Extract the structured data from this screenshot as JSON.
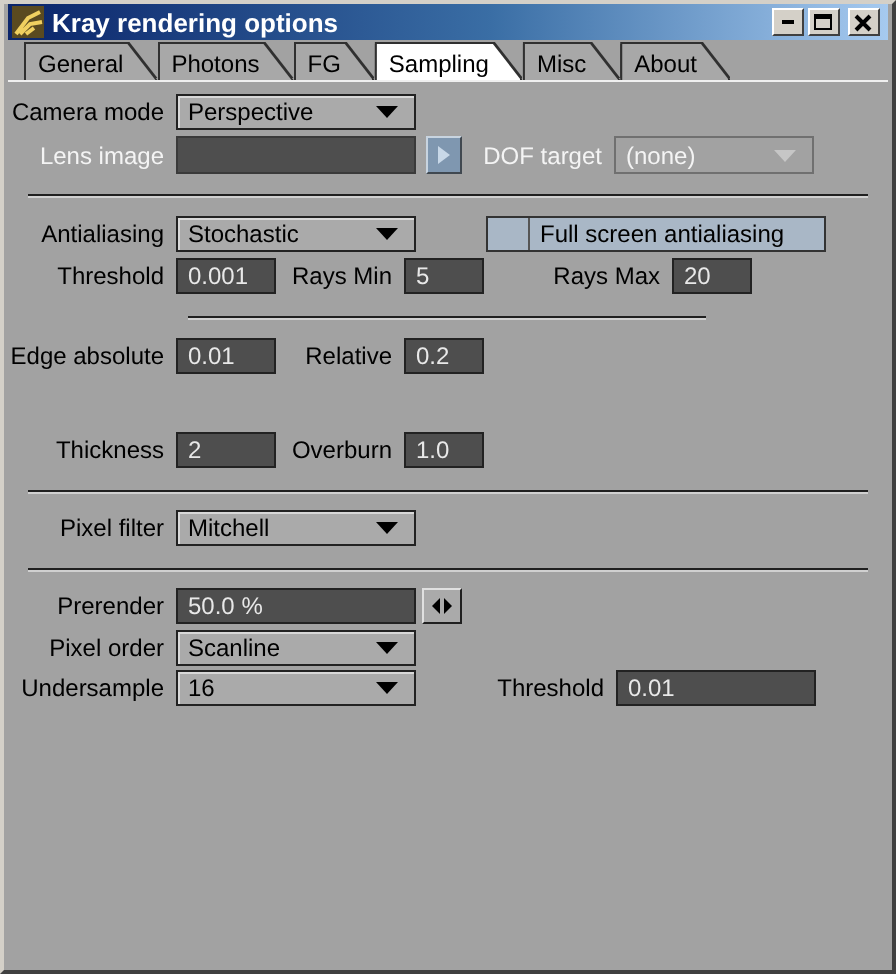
{
  "window": {
    "title": "Kray rendering options"
  },
  "tabs": [
    {
      "label": "General",
      "selected": false
    },
    {
      "label": "Photons",
      "selected": false
    },
    {
      "label": "FG",
      "selected": false
    },
    {
      "label": "Sampling",
      "selected": true
    },
    {
      "label": "Misc",
      "selected": false
    },
    {
      "label": "About",
      "selected": false
    }
  ],
  "rows": [
    {
      "kind": "controls",
      "items": [
        {
          "kind": "dropdown",
          "label": "Camera mode",
          "value": "Perspective",
          "disabled": false
        }
      ]
    },
    {
      "kind": "controls",
      "items": [
        {
          "kind": "field",
          "label": "Lens image",
          "disabled": true
        },
        {
          "kind": "arrow-button",
          "disabled": false
        },
        {
          "kind": "dropdown",
          "label": "DOF target",
          "value": "(none)",
          "disabled": true
        }
      ]
    },
    {
      "kind": "separator"
    },
    {
      "kind": "controls",
      "items": [
        {
          "kind": "dropdown",
          "label": "Antialiasing",
          "value": "Stochastic",
          "disabled": false
        },
        {
          "kind": "toggle",
          "label": "Full screen antialiasing",
          "checked": false
        }
      ]
    },
    {
      "kind": "controls",
      "items": [
        {
          "kind": "field",
          "label": "Threshold",
          "value": "0.001",
          "disabled": false
        },
        {
          "kind": "field",
          "label": "Rays Min",
          "value": "5",
          "disabled": false
        },
        {
          "kind": "field",
          "label": "Rays Max",
          "value": "20",
          "disabled": false
        }
      ]
    },
    {
      "kind": "short-separator"
    },
    {
      "kind": "controls",
      "items": [
        {
          "kind": "field",
          "label": "Edge absolute",
          "value": "0.01",
          "disabled": false
        },
        {
          "kind": "field",
          "label": "Relative",
          "value": "0.2",
          "disabled": false
        }
      ]
    },
    {
      "kind": "controls",
      "items": [
        {
          "kind": "field",
          "label": "Thickness",
          "value": "2",
          "disabled": false
        },
        {
          "kind": "field",
          "label": "Overburn",
          "value": "1.0",
          "disabled": false
        }
      ]
    },
    {
      "kind": "separator"
    },
    {
      "kind": "controls",
      "items": [
        {
          "kind": "dropdown",
          "label": "Pixel filter",
          "value": "Mitchell",
          "disabled": false
        }
      ]
    },
    {
      "kind": "separator"
    },
    {
      "kind": "controls",
      "items": [
        {
          "kind": "field",
          "label": "Prerender",
          "value": "50.0 %",
          "disabled": false
        },
        {
          "kind": "slider-button",
          "disabled": false
        }
      ]
    },
    {
      "kind": "controls",
      "items": [
        {
          "kind": "dropdown",
          "label": "Pixel order",
          "value": "Scanline",
          "disabled": false
        }
      ]
    },
    {
      "kind": "controls",
      "items": [
        {
          "kind": "dropdown",
          "label": "Undersample",
          "value": "16",
          "disabled": false
        },
        {
          "kind": "field",
          "label": "Threshold",
          "value": "0.01",
          "disabled": false
        }
      ]
    }
  ]
}
